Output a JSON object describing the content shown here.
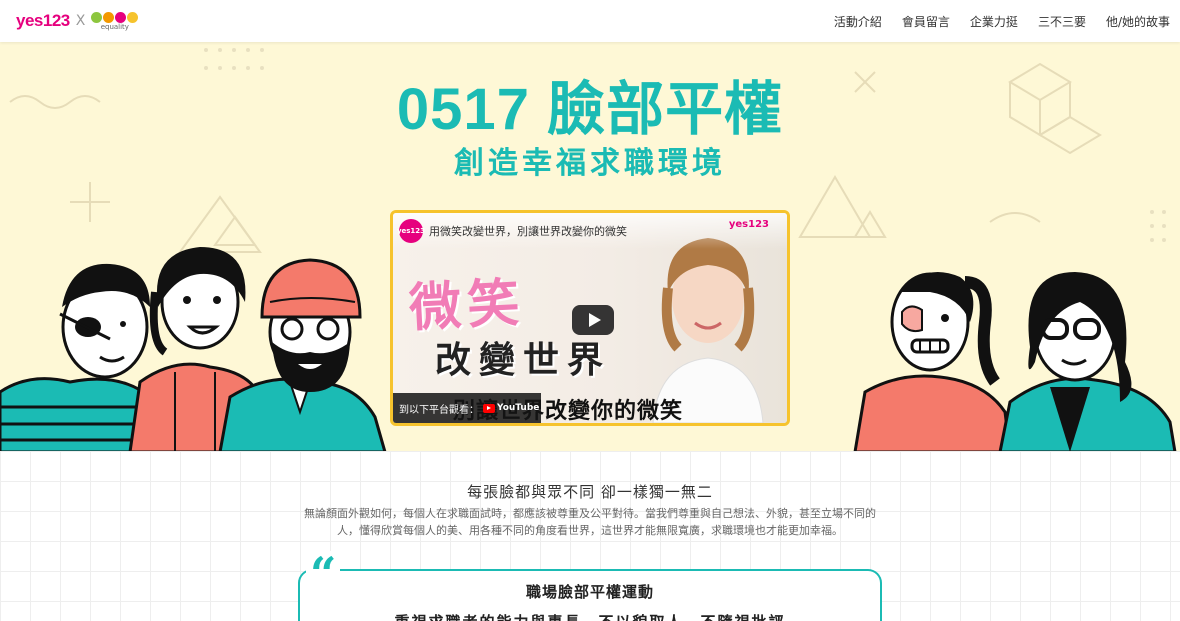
{
  "header": {
    "logo_yes": "yes123",
    "logo_x": "X",
    "logo_equality": "equality",
    "nav": [
      "活動介紹",
      "會員留言",
      "企業力挺",
      "三不三要",
      "他/她的故事"
    ]
  },
  "hero": {
    "title": "0517 臉部平權",
    "subtitle": "創造幸福求職環境"
  },
  "video": {
    "channel_badge": "yes123",
    "title": "用微笑改變世界，別讓世界改變你的微笑",
    "brand": "yes123",
    "big_text": "微笑",
    "mid_text": "改變世界",
    "sub_text": "別讓世界改變你的微笑",
    "watch_on": "到以下平台觀看：",
    "youtube": "YouTube"
  },
  "content": {
    "title": "每張臉都與眾不同 卻一樣獨一無二",
    "desc": "無論顏面外觀如何，每個人在求職面試時，都應該被尊重及公平對待。當我們尊重與自己想法、外貌，甚至立場不同的人，懂得欣賞每個人的美、用各種不同的角度看世界，這世界才能無限寬廣，求職環境也才能更加幸福。",
    "quote_mark": "“",
    "campaign_title": "職場臉部平權運動",
    "campaign_line": "重視求職者的能力與專長，不以貌取人、不隨視批評"
  },
  "colors": {
    "teal": "#1bbbb4",
    "pink": "#e6007e",
    "yellow": "#f6c32d",
    "hero_bg": "#fef8d6"
  }
}
